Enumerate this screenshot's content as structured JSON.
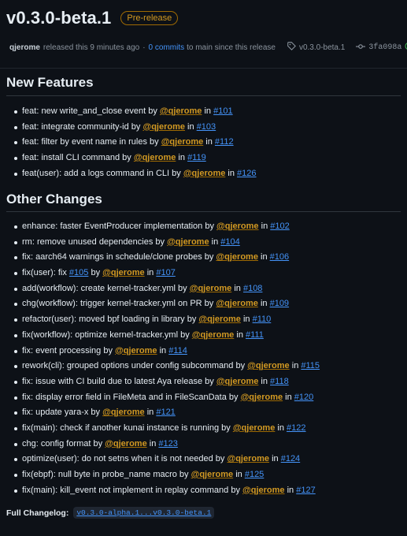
{
  "release": {
    "title": "v0.3.0-beta.1",
    "badge": "Pre-release",
    "author": "qjerome",
    "released_text": "released this 9 minutes ago",
    "sep": "·",
    "commits_link": "0 commits",
    "commits_suffix": "to main since this release",
    "tag": "v0.3.0-beta.1",
    "commit_hash": "3fa098a"
  },
  "sections": {
    "new_features": {
      "heading": "New Features",
      "items": [
        {
          "pre": "feat: new write_and_close event by ",
          "mention": "@qjerome",
          "mid": " in ",
          "pr": "#101"
        },
        {
          "pre": "feat: integrate community-id by ",
          "mention": "@qjerome",
          "mid": " in ",
          "pr": "#103"
        },
        {
          "pre": "feat: filter by event name in rules by ",
          "mention": "@qjerome",
          "mid": " in ",
          "pr": "#112"
        },
        {
          "pre": "feat: install CLI command by ",
          "mention": "@qjerome",
          "mid": " in ",
          "pr": "#119"
        },
        {
          "pre": "feat(user): add a logs command in CLI by ",
          "mention": "@qjerome",
          "mid": " in ",
          "pr": "#126"
        }
      ]
    },
    "other_changes": {
      "heading": "Other Changes",
      "items": [
        {
          "pre": "enhance: faster EventProducer implementation by ",
          "mention": "@qjerome",
          "mid": " in ",
          "pr": "#102"
        },
        {
          "pre": "rm: remove unused dependencies by ",
          "mention": "@qjerome",
          "mid": " in ",
          "pr": "#104"
        },
        {
          "pre": "fix: aarch64 warnings in schedule/clone probes by ",
          "mention": "@qjerome",
          "mid": " in ",
          "pr": "#106"
        },
        {
          "pre": "fix(user): fix ",
          "pr_inline": "#105",
          "pre2": " by ",
          "mention": "@qjerome",
          "mid": " in ",
          "pr": "#107"
        },
        {
          "pre": "add(workflow): create kernel-tracker.yml by ",
          "mention": "@qjerome",
          "mid": " in ",
          "pr": "#108"
        },
        {
          "pre": "chg(workflow): trigger kernel-tracker.yml on PR by ",
          "mention": "@qjerome",
          "mid": " in ",
          "pr": "#109"
        },
        {
          "pre": "refactor(user): moved bpf loading in library by ",
          "mention": "@qjerome",
          "mid": " in ",
          "pr": "#110"
        },
        {
          "pre": "fix(workflow): optimize kernel-tracker.yml by ",
          "mention": "@qjerome",
          "mid": " in ",
          "pr": "#111"
        },
        {
          "pre": "fix: event processing by ",
          "mention": "@qjerome",
          "mid": " in ",
          "pr": "#114"
        },
        {
          "pre": "rework(cli): grouped options under config subcommand by ",
          "mention": "@qjerome",
          "mid": " in ",
          "pr": "#115"
        },
        {
          "pre": "fix: issue with CI build due to latest Aya release by ",
          "mention": "@qjerome",
          "mid": " in ",
          "pr": "#118"
        },
        {
          "pre": "fix: display error field in FileMeta and in FileScanData by ",
          "mention": "@qjerome",
          "mid": " in ",
          "pr": "#120"
        },
        {
          "pre": "fix: update yara-x by ",
          "mention": "@qjerome",
          "mid": " in ",
          "pr": "#121"
        },
        {
          "pre": "fix(main): check if another kunai instance is running by ",
          "mention": "@qjerome",
          "mid": " in ",
          "pr": "#122"
        },
        {
          "pre": "chg: config format by ",
          "mention": "@qjerome",
          "mid": " in ",
          "pr": "#123"
        },
        {
          "pre": "optimize(user): do not setns when it is not needed by ",
          "mention": "@qjerome",
          "mid": " in ",
          "pr": "#124"
        },
        {
          "pre": "fix(ebpf): null byte in probe_name macro by ",
          "mention": "@qjerome",
          "mid": " in ",
          "pr": "#125"
        },
        {
          "pre": "fix(main): kill_event not implement in replay command by ",
          "mention": "@qjerome",
          "mid": " in ",
          "pr": "#127"
        }
      ]
    }
  },
  "changelog": {
    "label": "Full Changelog",
    "colon": ":",
    "link": "v0.3.0-alpha.1...v0.3.0-beta.1"
  }
}
